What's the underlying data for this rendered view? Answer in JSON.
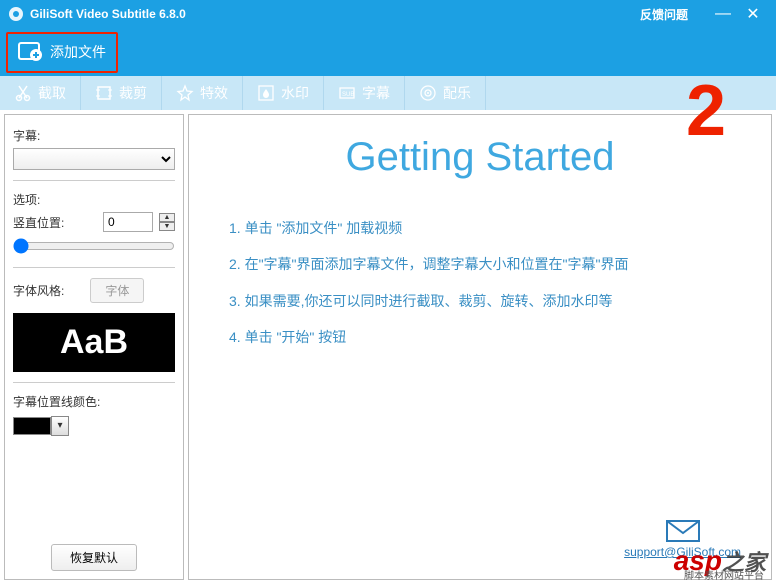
{
  "titlebar": {
    "title": "GiliSoft Video Subtitle 6.8.0",
    "feedback": "反馈问题",
    "minimize": "—",
    "close": "✕"
  },
  "toolbar": {
    "add_file": "添加文件"
  },
  "tabs": {
    "cut": "截取",
    "crop": "裁剪",
    "effect": "特效",
    "watermark": "水印",
    "subtitle": "字幕",
    "music": "配乐"
  },
  "annotation": {
    "number": "2"
  },
  "sidebar": {
    "subtitle_label": "字幕:",
    "options_label": "选项:",
    "vpos_label": "竖直位置:",
    "vpos_value": "0",
    "font_style_label": "字体风格:",
    "font_btn": "字体",
    "preview": "AaB",
    "line_color_label": "字幕位置线颜色:",
    "restore": "恢复默认"
  },
  "main": {
    "title": "Getting Started",
    "steps": {
      "s1": "1. 单击 \"添加文件\" 加载视频",
      "s2": "2. 在\"字幕\"界面添加字幕文件，调整字幕大小和位置在\"字幕\"界面",
      "s3": "3. 如果需要,你还可以同时进行截取、裁剪、旋转、添加水印等",
      "s4": "4. 单击 \"开始\" 按钮"
    },
    "support_email": "support@GiliSoft.com"
  },
  "watermark": {
    "asp": "asp",
    "rest": "之家",
    "sub": "脚本素材网站平台"
  }
}
